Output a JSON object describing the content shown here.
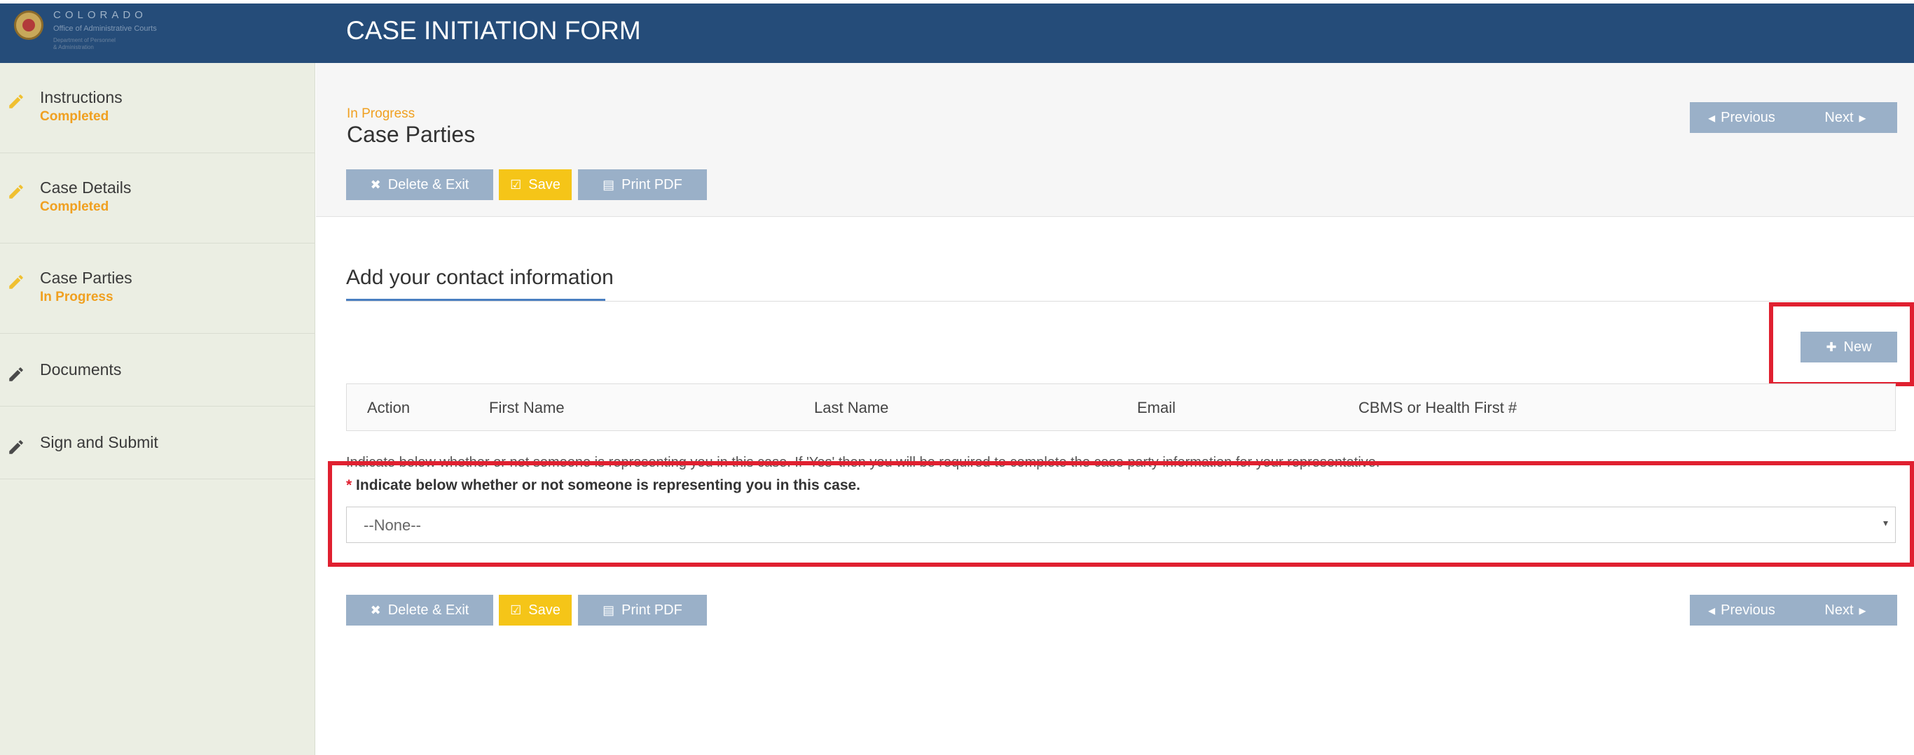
{
  "header": {
    "brand": "COLORADO",
    "brand_sub": "Office of Administrative Courts",
    "brand_sub2": "Department of Personnel",
    "brand_sub3": "& Administration",
    "form_title": "CASE INITIATION FORM"
  },
  "sidebar": {
    "items": [
      {
        "label": "Instructions",
        "status": "Completed"
      },
      {
        "label": "Case Details",
        "status": "Completed"
      },
      {
        "label": "Case Parties",
        "status": "In Progress"
      },
      {
        "label": "Documents",
        "status": ""
      },
      {
        "label": "Sign and Submit",
        "status": ""
      }
    ]
  },
  "page": {
    "status": "In Progress",
    "title": "Case Parties"
  },
  "toolbar": {
    "delete_label": "Delete & Exit",
    "save_label": "Save",
    "print_label": "Print PDF"
  },
  "pager": {
    "previous_label": "Previous",
    "next_label": "Next"
  },
  "contact": {
    "tab_title": "Add your contact information",
    "new_label": "New",
    "columns": [
      "Action",
      "First Name",
      "Last Name",
      "Email",
      "CBMS or Health First #"
    ]
  },
  "representation": {
    "help_text": "Indicate below whether or not someone is representing you in this case. If 'Yes' then you will be required to complete the case party information for your representative.",
    "required_star": "*",
    "label": "Indicate below whether or not someone is representing you in this case.",
    "selected_value": "--None--"
  },
  "icons": {
    "sidebar_completed": "pencil-icon",
    "sidebar_pending": "pencil-icon",
    "delete": "times-icon",
    "save": "check-square-icon",
    "print": "file-pdf-icon",
    "new": "plus-icon",
    "previous": "caret-left-icon",
    "next": "caret-right-icon",
    "select": "caret-down-icon"
  },
  "colors": {
    "header_bg": "#254c79",
    "accent_status": "#f0a020",
    "button_gray": "#9ab0c8",
    "button_yellow": "#f5c518",
    "highlight_red": "#e02030",
    "tab_underline": "#4a7fc1"
  }
}
